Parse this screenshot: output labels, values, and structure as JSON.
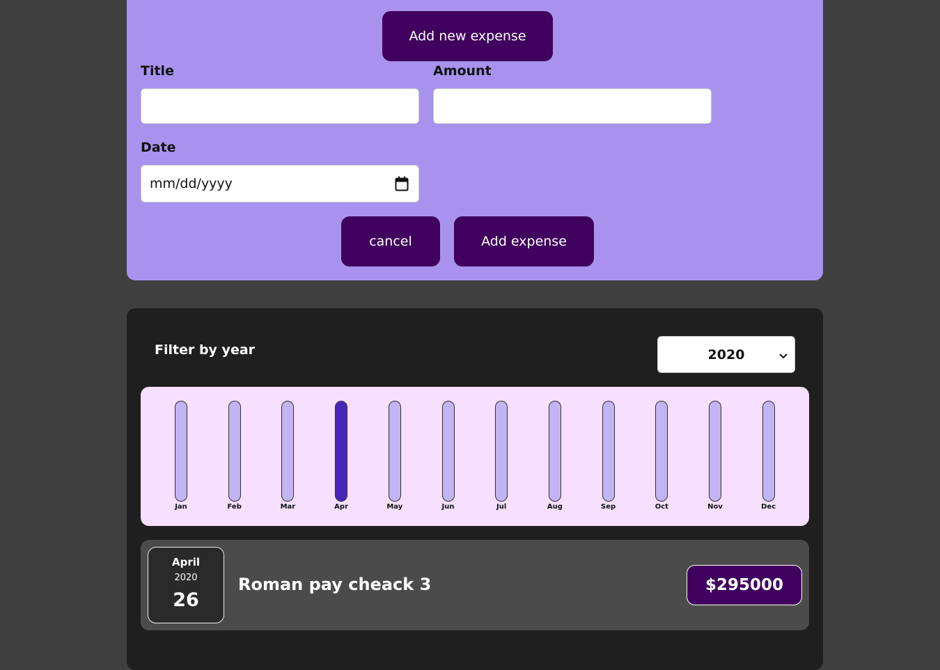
{
  "form": {
    "open_button_label": "Add new expense",
    "title_label": "Title",
    "title_value": "",
    "amount_label": "Amount",
    "amount_value": "",
    "date_label": "Date",
    "date_placeholder": "mm/dd/yyyy",
    "cancel_label": "cancel",
    "submit_label": "Add expense"
  },
  "filter": {
    "label": "Filter by year",
    "selected_year": "2020"
  },
  "chart_data": {
    "type": "bar",
    "categories": [
      "Jan",
      "Feb",
      "Mar",
      "Apr",
      "May",
      "Jun",
      "Jul",
      "Aug",
      "Sep",
      "Oct",
      "Nov",
      "Dec"
    ],
    "values": [
      0,
      0,
      0,
      295000,
      0,
      0,
      0,
      0,
      0,
      0,
      0,
      0
    ],
    "ylim": [
      0,
      295000
    ]
  },
  "expenses": [
    {
      "month": "April",
      "year": "2020",
      "day": "26",
      "title": "Roman pay cheack 3",
      "amount": "$295000"
    }
  ],
  "colors": {
    "page_bg": "#3f3f3f",
    "form_bg": "#a892ee",
    "button_bg": "#40005d",
    "chart_bg": "#f7dfff",
    "bar_track": "#c3b4f3",
    "bar_fill": "#4826b9",
    "card_bg": "#1f1f1f",
    "item_bg": "#4b4b4b"
  }
}
